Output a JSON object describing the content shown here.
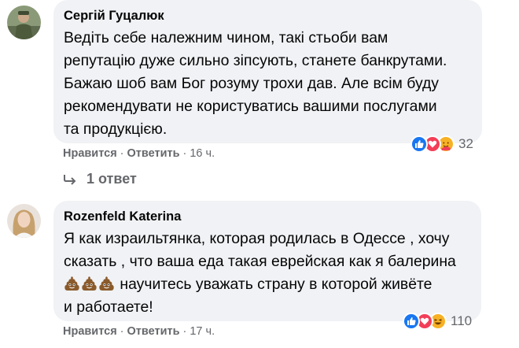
{
  "comments": [
    {
      "author": "Сергій Гуцалюк",
      "avatar_icon": "user-avatar-military",
      "lines": [
        "Ведіть себе належним чином, такі стьоби вам",
        "репутацію дуже сильно зіпсують, станете банкрутами.",
        "Бажаю шоб вам Бог розуму трохи дав. Але всім буду",
        "рекомендувати не користуватись вашими послугами",
        "та продукцією."
      ],
      "like_label": "Нравится",
      "reply_label": "Ответить",
      "time": "16 ч.",
      "reactions": [
        "like-icon",
        "love-icon",
        "care-icon"
      ],
      "reaction_count": "32",
      "replies_label": "1 ответ"
    },
    {
      "author": "Rozenfeld Katerina",
      "avatar_icon": "user-avatar-woman",
      "line1": "Я как израильтянка, которая родилась в Одессе , хочу",
      "line2": "сказать , что ваша еда такая еврейская как я балерина",
      "line3_text": " научитесь уважать страну в которой живёте",
      "line3_emoji": [
        "pile-of-poo-icon",
        "pile-of-poo-icon",
        "pile-of-poo-icon"
      ],
      "line4": "и работаете!",
      "like_label": "Нравится",
      "reply_label": "Ответить",
      "time": "17 ч.",
      "reactions": [
        "like-icon",
        "love-icon",
        "haha-icon"
      ],
      "reaction_count": "110"
    }
  ],
  "colors": {
    "bubble": "#f0f2f5",
    "meta_text": "#65676b",
    "like_blue": "#1877f2",
    "love_red": "#f33e58",
    "emoji_yellow": "#f7b125"
  }
}
